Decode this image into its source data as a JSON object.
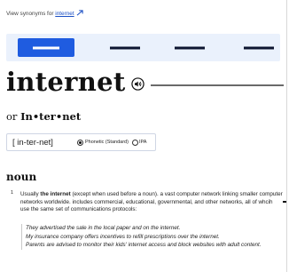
{
  "header": {
    "synonyms_prefix": "View synonyms for",
    "synonyms_link": "internet"
  },
  "tabs": [
    {
      "active": true
    },
    {
      "active": false
    },
    {
      "active": false
    },
    {
      "active": false
    }
  ],
  "entry": {
    "headword": "internet",
    "variant_prefix": "or",
    "variant_word": "In•ter•net",
    "pronunciation": "[ in-ter-net]",
    "pronunciation_options": [
      "Phonetic (Standard)",
      "IPA"
    ],
    "selected_pronunciation": "Phonetic (Standard)",
    "part_of_speech": "noun"
  },
  "definition": {
    "number": "1",
    "lead": "Usually",
    "bold": "the internet",
    "text": " (except  when used before a noun). a vast computer network linking smaller computer networks worldwide. includes commercial, educational, governmental, and other networks, all of whcih use the same set of communications protocols:"
  },
  "examples": [
    "They advertised the sale in the local paper and on the internet.",
    "My insurance company offers incentives to refill prescriptions over the internet.",
    "Parents are advised to monitor their kids' internet access and block websites with adult content."
  ],
  "colors": {
    "accent": "#1f5ce0",
    "link": "#1b4fc4",
    "tabbar_bg": "#eaf1fc"
  },
  "icons": {
    "external_link": "arrow-up-right-icon",
    "audio": "speaker-icon"
  }
}
